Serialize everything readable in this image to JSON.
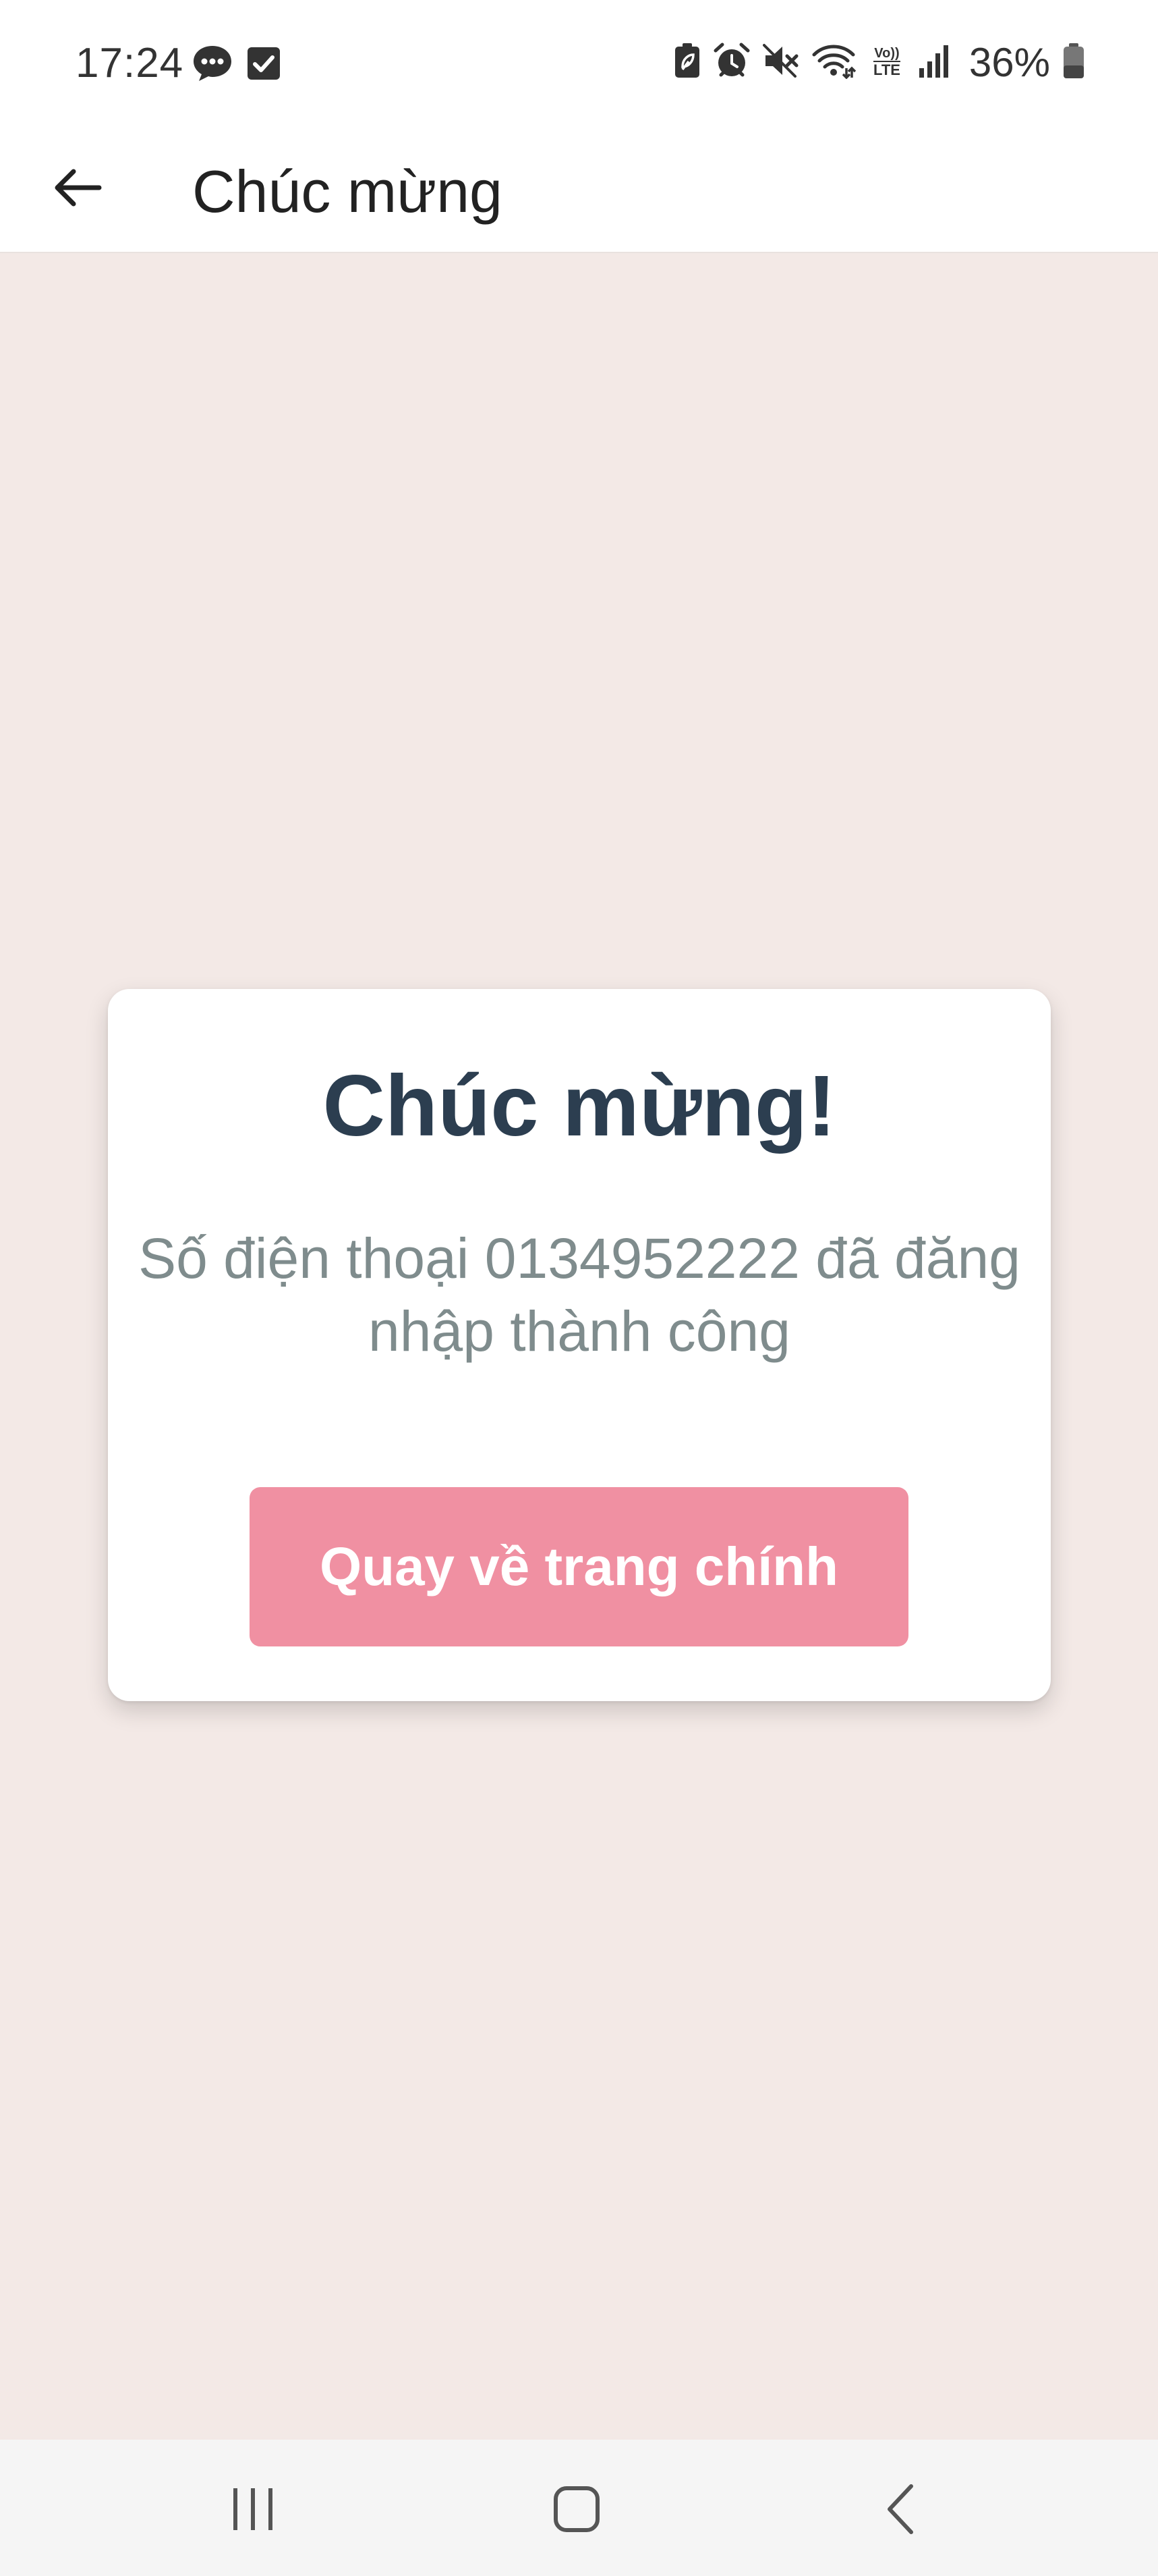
{
  "status_bar": {
    "time": "17:24",
    "battery_percent": "36%",
    "left_icons": [
      "chat-bubble-icon",
      "checkbox-icon"
    ],
    "right_icons": [
      "battery-saver-icon",
      "alarm-icon",
      "mute-icon",
      "wifi-icon",
      "volte-icon",
      "signal-icon",
      "battery-icon"
    ]
  },
  "app_bar": {
    "title": "Chúc mừng",
    "back_icon": "arrow-left-icon"
  },
  "card": {
    "title": "Chúc mừng!",
    "message": "Số điện thoại 0134952222 đã đăng nhập thành công",
    "button_label": "Quay về trang chính"
  },
  "nav_bar": {
    "icons": [
      "recent-apps-icon",
      "home-icon",
      "back-icon"
    ]
  },
  "colors": {
    "background": "#f3e9e6",
    "card_title": "#2c3e50",
    "message_text": "#7f8c8d",
    "button": "#f090a2",
    "button_text": "#ffffff"
  }
}
